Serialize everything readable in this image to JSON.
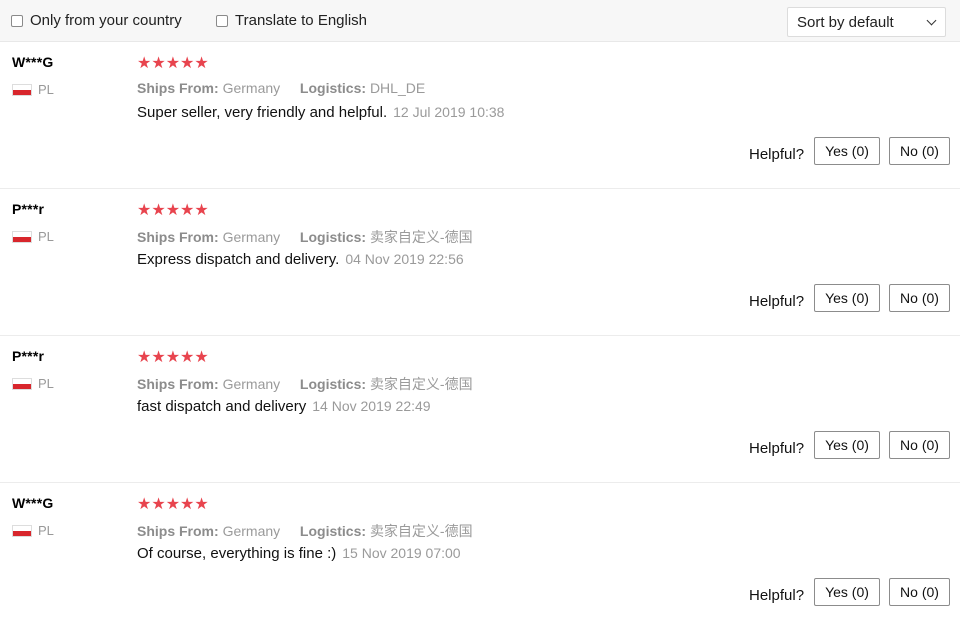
{
  "filters": {
    "only_country_label": "Only from your country",
    "translate_label": "Translate to English"
  },
  "sort": {
    "selected": "Sort by default"
  },
  "icons": {
    "star": "star-icon",
    "flag": "flag-icon",
    "checkbox": "checkbox-icon",
    "dropdown": "chevron-down-icon"
  },
  "colors": {
    "star": "#e8444e",
    "meta": "#9a9a9a"
  },
  "labels": {
    "ships_from_key": "Ships From:",
    "logistics_key": "Logistics:",
    "helpful": "Helpful?"
  },
  "reviews": [
    {
      "user": "W***G",
      "country": "PL",
      "rating": 5,
      "stars": "★★★★★",
      "ships_from": "Germany",
      "logistics": "DHL_DE",
      "text": "Super seller, very friendly and helpful.",
      "date": "12 Jul 2019 10:38",
      "yes": "Yes (0)",
      "no": "No (0)"
    },
    {
      "user": "P***r",
      "country": "PL",
      "rating": 5,
      "stars": "★★★★★",
      "ships_from": "Germany",
      "logistics": "卖家自定义-德国",
      "text": "Express dispatch and delivery.",
      "date": "04 Nov 2019 22:56",
      "yes": "Yes (0)",
      "no": "No (0)"
    },
    {
      "user": "P***r",
      "country": "PL",
      "rating": 5,
      "stars": "★★★★★",
      "ships_from": "Germany",
      "logistics": "卖家自定义-德国",
      "text": "fast dispatch and delivery",
      "date": "14 Nov 2019 22:49",
      "yes": "Yes (0)",
      "no": "No (0)"
    },
    {
      "user": "W***G",
      "country": "PL",
      "rating": 5,
      "stars": "★★★★★",
      "ships_from": "Germany",
      "logistics": "卖家自定义-德国",
      "text": "Of course, everything is fine :)",
      "date": "15 Nov 2019 07:00",
      "yes": "Yes (0)",
      "no": "No (0)"
    }
  ]
}
